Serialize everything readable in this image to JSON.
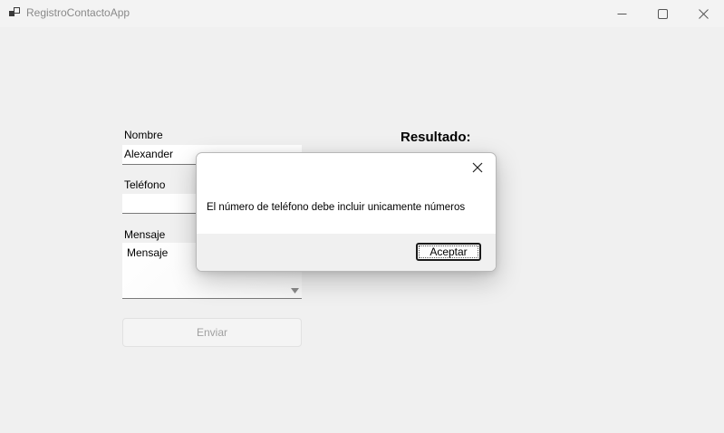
{
  "window": {
    "title": "RegistroContactoApp",
    "icons": [
      "app-icon",
      "minimize-icon",
      "maximize-icon",
      "close-icon"
    ]
  },
  "form": {
    "name_label": "Nombre",
    "name_value": "Alexander",
    "phone_label": "Teléfono",
    "phone_value": "",
    "message_label": "Mensaje",
    "message_value": "Mensaje",
    "send_label": "Enviar"
  },
  "result": {
    "label": "Resultado:"
  },
  "dialog": {
    "message": "El número de teléfono debe incluir unicamente números",
    "ok_label": "Aceptar"
  }
}
